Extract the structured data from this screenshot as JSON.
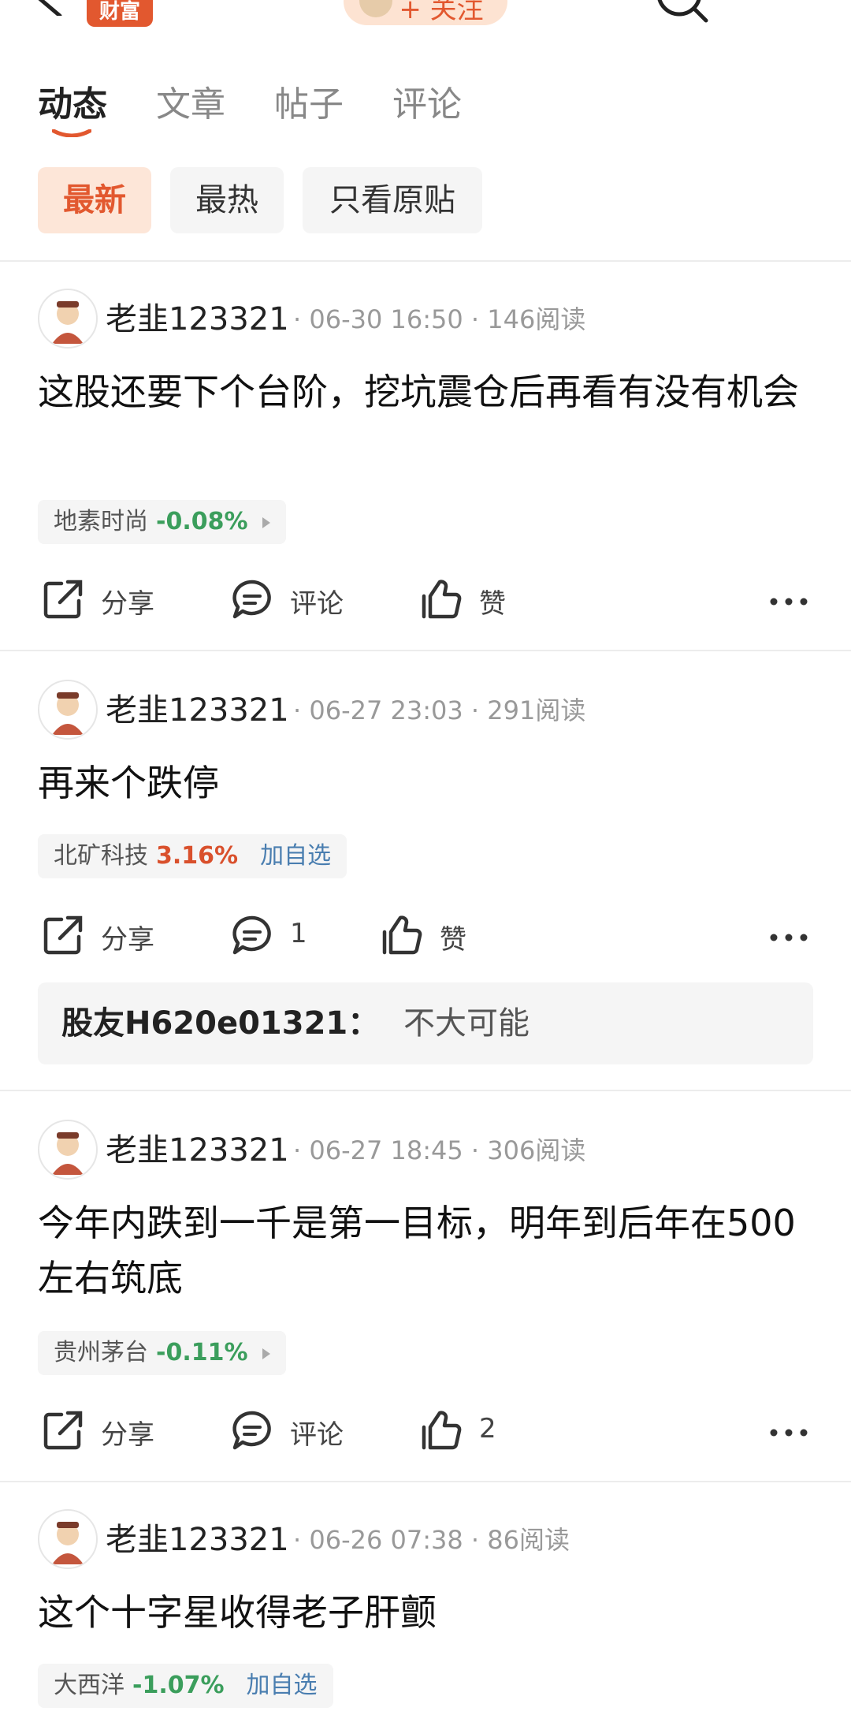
{
  "header": {
    "badge": "财富",
    "follow_label": "+ 关注",
    "icons": [
      "back-icon",
      "search-icon",
      "more-icon"
    ]
  },
  "tabs": [
    {
      "label": "动态",
      "active": true
    },
    {
      "label": "文章",
      "active": false
    },
    {
      "label": "帖子",
      "active": false
    },
    {
      "label": "评论",
      "active": false
    }
  ],
  "filters": [
    {
      "label": "最新",
      "active": true
    },
    {
      "label": "最热",
      "active": false
    },
    {
      "label": "只看原贴",
      "active": false
    }
  ],
  "colors": {
    "accent": "#e2582f",
    "down": "#3b9e5c",
    "up": "#d9502c",
    "link": "#4a7eb0"
  },
  "posts": [
    {
      "user": "老韭123321",
      "meta": "· 06-30 16:50 · 146阅读",
      "text": "这股还要下个台阶，挖坑震仓后再看有没有机会",
      "stock": {
        "name": "地素时尚",
        "change": "-0.08%",
        "direction": "down",
        "add_watch": ""
      },
      "share": "分享",
      "comment": "评论",
      "like": "赞"
    },
    {
      "user": "老韭123321",
      "meta": "· 06-27 23:03 · 291阅读",
      "text": "再来个跌停",
      "stock": {
        "name": "北矿科技",
        "change": "3.16%",
        "direction": "up",
        "add_watch": "加自选"
      },
      "share": "分享",
      "comment": "1",
      "like": "赞",
      "reply": {
        "user": "股友H620e01321：",
        "text": "不大可能"
      }
    },
    {
      "user": "老韭123321",
      "meta": "· 06-27 18:45 · 306阅读",
      "text": "今年内跌到一千是第一目标，明年到后年在500左右筑底",
      "stock": {
        "name": "贵州茅台",
        "change": "-0.11%",
        "direction": "down",
        "add_watch": ""
      },
      "share": "分享",
      "comment": "评论",
      "like": "2"
    },
    {
      "user": "老韭123321",
      "meta": "· 06-26 07:38 · 86阅读",
      "text": "这个十字星收得老子肝颤",
      "stock": {
        "name": "大西洋",
        "change": "-1.07%",
        "direction": "down",
        "add_watch": "加自选"
      }
    }
  ]
}
